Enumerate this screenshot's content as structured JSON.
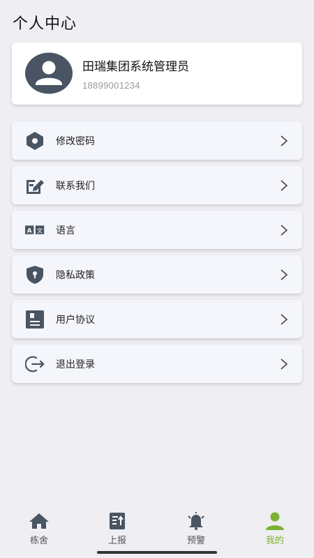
{
  "header": {
    "title": "个人中心"
  },
  "profile": {
    "name": "田瑞集团系统管理员",
    "phone": "18899001234"
  },
  "menu": [
    {
      "label": "修改密码",
      "icon": "hexagon-key-icon"
    },
    {
      "label": "联系我们",
      "icon": "edit-note-icon"
    },
    {
      "label": "语言",
      "icon": "translate-icon"
    },
    {
      "label": "隐私政策",
      "icon": "shield-lock-icon"
    },
    {
      "label": "用户协议",
      "icon": "document-icon"
    },
    {
      "label": "退出登录",
      "icon": "logout-icon"
    }
  ],
  "tabbar": {
    "tabs": [
      {
        "label": "栋舍",
        "icon": "home-icon"
      },
      {
        "label": "上报",
        "icon": "report-icon"
      },
      {
        "label": "预警",
        "icon": "alarm-bell-icon"
      },
      {
        "label": "我的",
        "icon": "person-icon"
      }
    ],
    "active_index": 3
  },
  "colors": {
    "accent": "#7cb232",
    "icon": "#4a5563",
    "background": "#eeeef3",
    "card": "#f4f6fc"
  }
}
